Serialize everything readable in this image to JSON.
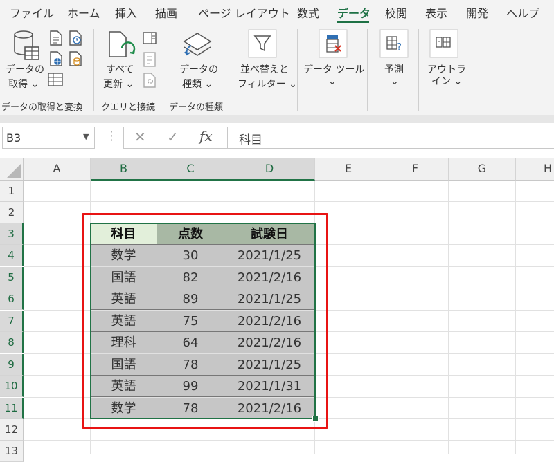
{
  "menu": {
    "tabs": [
      {
        "label": "ファイル",
        "active": false
      },
      {
        "label": "ホーム",
        "active": false
      },
      {
        "label": "挿入",
        "active": false
      },
      {
        "label": "描画",
        "active": false
      },
      {
        "label": "ページ レイアウト",
        "active": false
      },
      {
        "label": "数式",
        "active": false
      },
      {
        "label": "データ",
        "active": true
      },
      {
        "label": "校閲",
        "active": false
      },
      {
        "label": "表示",
        "active": false
      },
      {
        "label": "開発",
        "active": false
      },
      {
        "label": "ヘルプ",
        "active": false
      }
    ]
  },
  "ribbon": {
    "get_data": {
      "line1": "データの",
      "line2": "取得 ⌄"
    },
    "refresh_all": {
      "line1": "すべて",
      "line2": "更新 ⌄"
    },
    "data_types": {
      "line1": "データの",
      "line2": "種類 ⌄"
    },
    "sort_filter": {
      "line1": "並べ替えと",
      "line2": "フィルター ⌄"
    },
    "data_tools": {
      "line1": "データ ツール",
      "line2": "⌄"
    },
    "forecast": {
      "line1": "予測",
      "line2": "⌄"
    },
    "outline": {
      "line1": "アウトラ",
      "line2": "イン ⌄"
    },
    "groups": {
      "get_transform": "データの取得と変換",
      "queries_connections": "クエリと接続",
      "data_types": "データの種類"
    }
  },
  "formula_bar": {
    "name_box": "B3",
    "name_box_arrow": "▼",
    "more": "⋮",
    "cancel": "✕",
    "enter": "✓",
    "fx": "fx",
    "content": "科目"
  },
  "sheet": {
    "columns": [
      "A",
      "B",
      "C",
      "D",
      "E",
      "F",
      "G",
      "H"
    ],
    "rows": [
      "1",
      "2",
      "3",
      "4",
      "5",
      "6",
      "7",
      "8",
      "9",
      "10",
      "11",
      "12",
      "13"
    ],
    "table": {
      "headers": [
        "科目",
        "点数",
        "試験日"
      ],
      "rows": [
        [
          "数学",
          "30",
          "2021/1/25"
        ],
        [
          "国語",
          "82",
          "2021/2/16"
        ],
        [
          "英語",
          "89",
          "2021/1/25"
        ],
        [
          "英語",
          "75",
          "2021/2/16"
        ],
        [
          "理科",
          "64",
          "2021/2/16"
        ],
        [
          "国語",
          "78",
          "2021/1/25"
        ],
        [
          "英語",
          "99",
          "2021/1/31"
        ],
        [
          "数学",
          "78",
          "2021/2/16"
        ]
      ]
    }
  },
  "colors": {
    "accent": "#217346",
    "highlight_frame": "#e81414",
    "header_fill": "#a8b8a4",
    "data_fill": "#c6c6c6",
    "active_cell_fill": "#e2efda"
  },
  "icons": [
    "database-icon",
    "text-csv-icon",
    "web-icon",
    "table-icon",
    "recent-sources-icon",
    "existing-connections-icon",
    "refresh-icon",
    "properties-icon",
    "edit-links-icon",
    "data-types-icon",
    "filter-icon",
    "data-tools-icon",
    "forecast-icon",
    "outline-icon"
  ]
}
